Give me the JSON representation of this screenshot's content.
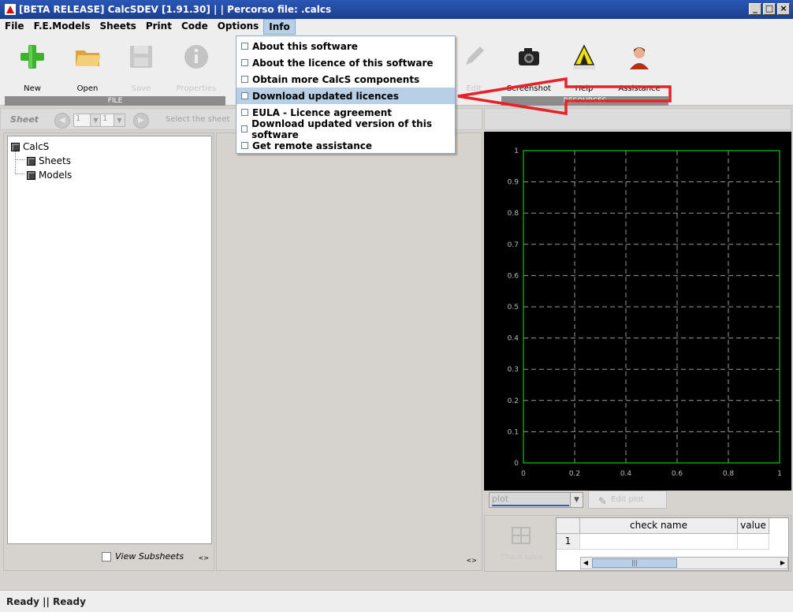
{
  "window": {
    "title": "[BETA RELEASE] CalcSDEV [1.91.30] | | Percorso file: .calcs",
    "buttons": [
      "_",
      "□",
      "×"
    ]
  },
  "menubar": {
    "items": [
      "File",
      "F.E.Models",
      "Sheets",
      "Print",
      "Code",
      "Options",
      "Info"
    ],
    "active": "Info"
  },
  "toolbar": {
    "tools": [
      {
        "label": "New",
        "icon": "plus-icon",
        "enabled": true
      },
      {
        "label": "Open",
        "icon": "folder-icon",
        "enabled": true
      },
      {
        "label": "Save",
        "icon": "floppy-icon",
        "enabled": false
      },
      {
        "label": "Properties",
        "icon": "info-icon",
        "enabled": false
      },
      {
        "label": "Edit",
        "icon": "pencil-icon",
        "enabled": false
      },
      {
        "label": "Screenshot",
        "icon": "camera-icon",
        "enabled": true
      },
      {
        "label": "Help",
        "icon": "help-tent-icon",
        "enabled": true
      },
      {
        "label": "Assistance",
        "icon": "support-person-icon",
        "enabled": true
      }
    ],
    "groups": {
      "file": "FILE",
      "resources": "RESOURCES"
    }
  },
  "info_menu": {
    "items": [
      "About this software",
      "About the licence of this software",
      "Obtain more CalcS components",
      "Download updated licences",
      "EULA - Licence agreement",
      "Download updated version of this software",
      "Get remote assistance"
    ],
    "highlighted_index": 3
  },
  "sheetbar": {
    "label": "Sheet",
    "spinner1": "1",
    "spinner2": "1",
    "select_label": "Select the sheet"
  },
  "tree": {
    "root": "CalcS",
    "children": [
      "Sheets",
      "Models"
    ],
    "view_subsheets_label": "View Subsheets",
    "resize_glyph": "<>"
  },
  "chart_data": {
    "type": "line",
    "series": [],
    "xlim": [
      0,
      1
    ],
    "ylim": [
      0,
      1
    ],
    "x_ticks": [
      "0",
      "0.2",
      "0.4",
      "0.6",
      "0.8",
      "1"
    ],
    "y_ticks": [
      "0",
      "0.1",
      "0.2",
      "0.3",
      "0.4",
      "0.5",
      "0.6",
      "0.7",
      "0.8",
      "0.9",
      "1"
    ],
    "grid": true,
    "background": "#000000",
    "axis_color": "#00cc00",
    "grid_color": "#c0c0c0"
  },
  "chart_controls": {
    "plot_select": "plot",
    "edit_button": "Edit plot"
  },
  "check_table": {
    "icon_label": "Check table",
    "columns": [
      "check name",
      "value"
    ],
    "rows": [
      {
        "index": "1",
        "check_name": "",
        "value": ""
      }
    ],
    "scroll_thumb": "|||"
  },
  "status": {
    "text": "Ready || Ready"
  },
  "colors": {
    "titlebar": "#2a57b5",
    "menu_highlight": "#b8cfe5",
    "annotation_arrow": "#e8202a"
  }
}
